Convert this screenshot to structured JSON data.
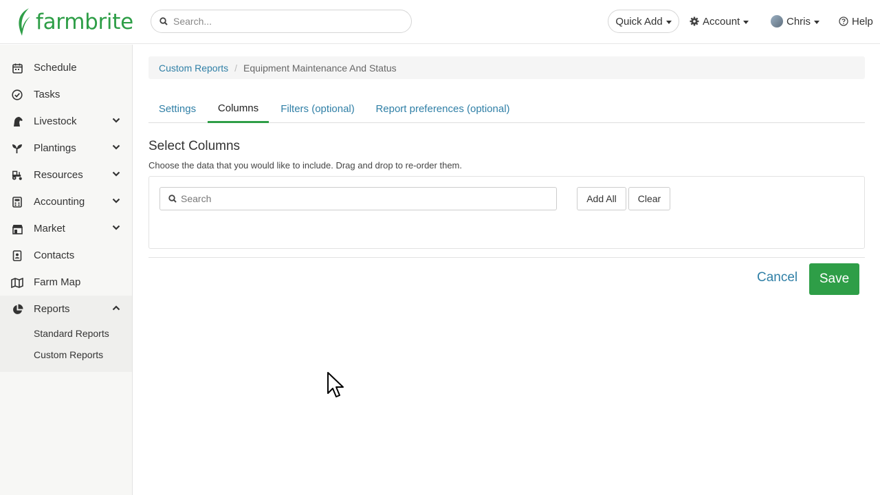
{
  "brand": {
    "name": "farmbrite",
    "color": "#2e9e47"
  },
  "topbar": {
    "search_placeholder": "Search...",
    "quick_add_label": "Quick Add",
    "account_label": "Account",
    "user_label": "Chris",
    "help_label": "Help"
  },
  "sidebar": {
    "items": [
      {
        "label": "Schedule",
        "icon": "calendar-icon"
      },
      {
        "label": "Tasks",
        "icon": "check-circle-icon"
      },
      {
        "label": "Livestock",
        "icon": "horse-icon"
      },
      {
        "label": "Plantings",
        "icon": "seedling-icon"
      },
      {
        "label": "Resources",
        "icon": "tractor-icon"
      },
      {
        "label": "Accounting",
        "icon": "calculator-icon"
      },
      {
        "label": "Market",
        "icon": "store-icon"
      },
      {
        "label": "Contacts",
        "icon": "address-book-icon"
      },
      {
        "label": "Farm Map",
        "icon": "map-icon"
      },
      {
        "label": "Reports",
        "icon": "chart-pie-icon"
      }
    ],
    "reports_sub": [
      "Standard Reports",
      "Custom Reports"
    ]
  },
  "breadcrumb": {
    "parent": "Custom Reports",
    "current": "Equipment Maintenance And Status"
  },
  "tabs": [
    "Settings",
    "Columns",
    "Filters (optional)",
    "Report preferences (optional)"
  ],
  "active_tab": "Columns",
  "columns": {
    "title": "Select Columns",
    "description": "Choose the data that you would like to include. Drag and drop to re-order them.",
    "search_placeholder": "Search",
    "add_all_label": "Add All",
    "clear_label": "Clear"
  },
  "actions": {
    "cancel_label": "Cancel",
    "save_label": "Save"
  },
  "colors": {
    "link": "#2f7fa6",
    "accent": "#2e9e47",
    "sidebar_bg": "#f7f7f5"
  }
}
